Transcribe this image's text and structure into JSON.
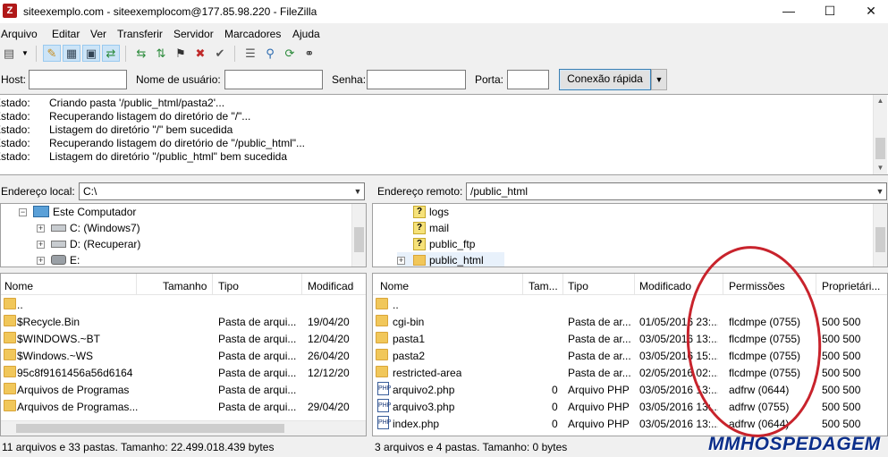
{
  "window": {
    "title": "siteexemplo.com - siteexemplocom@177.85.98.220 - FileZilla",
    "app_icon": "Z",
    "controls": {
      "minimize": "—",
      "maximize": "☐",
      "close": "✕"
    }
  },
  "menu": [
    "Arquivo",
    "Editar",
    "Ver",
    "Transferir",
    "Servidor",
    "Marcadores",
    "Ajuda"
  ],
  "toolbar_icons": [
    "site-manager-icon",
    "dropdown-arrow-icon",
    "toggle-log-icon",
    "toggle-local-tree-icon",
    "toggle-remote-tree-icon",
    "toggle-queue-icon",
    "refresh-icon",
    "process-queue-icon",
    "cancel-icon",
    "disconnect-icon",
    "reconnect-icon",
    "filter-icon",
    "compare-icon",
    "sync-browse-icon",
    "search-icon"
  ],
  "quickconnect": {
    "host_label": "Host:",
    "host_value": "",
    "user_label": "Nome de usuário:",
    "user_value": "",
    "pass_label": "Senha:",
    "pass_value": "",
    "port_label": "Porta:",
    "port_value": "",
    "button": "Conexão rápida",
    "dropdown": "▼"
  },
  "log": [
    {
      "key": "Estado:",
      "msg": "Criando pasta '/public_html/pasta2'..."
    },
    {
      "key": "Estado:",
      "msg": "Recuperando listagem do diretório de \"/\"..."
    },
    {
      "key": "Estado:",
      "msg": "Listagem do diretório \"/\" bem sucedida"
    },
    {
      "key": "Estado:",
      "msg": "Recuperando listagem do diretório de \"/public_html\"..."
    },
    {
      "key": "Estado:",
      "msg": "Listagem do diretório \"/public_html\" bem sucedida"
    }
  ],
  "local": {
    "address_label": "Endereço local:",
    "address_value": "C:\\",
    "tree": [
      {
        "label": "Este Computador",
        "icon": "computer-icon"
      },
      {
        "label": "C: (Windows7)",
        "icon": "drive-icon"
      },
      {
        "label": "D: (Recuperar)",
        "icon": "drive-icon"
      },
      {
        "label": "E:",
        "icon": "drive-icon"
      }
    ],
    "columns": [
      "Nome",
      "Tamanho",
      "Tipo",
      "Modificado"
    ],
    "files": [
      {
        "name": "..",
        "size": "",
        "type": "",
        "modified": ""
      },
      {
        "name": "$Recycle.Bin",
        "size": "",
        "type": "Pasta de arqui...",
        "modified": "19/04/20"
      },
      {
        "name": "$WINDOWS.~BT",
        "size": "",
        "type": "Pasta de arqui...",
        "modified": "12/04/20"
      },
      {
        "name": "$Windows.~WS",
        "size": "",
        "type": "Pasta de arqui...",
        "modified": "26/04/20"
      },
      {
        "name": "95c8f9161456a56d6164...",
        "size": "",
        "type": "Pasta de arqui...",
        "modified": "12/12/20"
      },
      {
        "name": "Arquivos de Programas",
        "size": "",
        "type": "Pasta de arqui...",
        "modified": ""
      },
      {
        "name": "Arquivos de Programas...",
        "size": "",
        "type": "Pasta de arqui...",
        "modified": "29/04/20"
      }
    ],
    "status": "11 arquivos e 33 pastas. Tamanho: 22.499.018.439 bytes"
  },
  "remote": {
    "address_label": "Endereço remoto:",
    "address_value": "/public_html",
    "tree": [
      {
        "label": "logs",
        "icon": "question-icon"
      },
      {
        "label": "mail",
        "icon": "question-icon"
      },
      {
        "label": "public_ftp",
        "icon": "question-icon"
      },
      {
        "label": "public_html",
        "icon": "folder-icon"
      }
    ],
    "columns": [
      "Nome",
      "Tam...",
      "Tipo",
      "Modificado",
      "Permissões",
      "Proprietári..."
    ],
    "files": [
      {
        "name": "..",
        "size": "",
        "type": "",
        "modified": "",
        "perms": "",
        "owner": "",
        "kind": "folder"
      },
      {
        "name": "cgi-bin",
        "size": "",
        "type": "Pasta de ar...",
        "modified": "01/05/2016 23:...",
        "perms": "flcdmpe (0755)",
        "owner": "500 500",
        "kind": "folder"
      },
      {
        "name": "pasta1",
        "size": "",
        "type": "Pasta de ar...",
        "modified": "03/05/2016 13:...",
        "perms": "flcdmpe (0755)",
        "owner": "500 500",
        "kind": "folder"
      },
      {
        "name": "pasta2",
        "size": "",
        "type": "Pasta de ar...",
        "modified": "03/05/2016 15:...",
        "perms": "flcdmpe (0755)",
        "owner": "500 500",
        "kind": "folder"
      },
      {
        "name": "restricted-area",
        "size": "",
        "type": "Pasta de ar...",
        "modified": "02/05/2016 02:...",
        "perms": "flcdmpe (0755)",
        "owner": "500 500",
        "kind": "folder"
      },
      {
        "name": "arquivo2.php",
        "size": "0",
        "type": "Arquivo PHP",
        "modified": "03/05/2016 13:...",
        "perms": "adfrw (0644)",
        "owner": "500 500",
        "kind": "php"
      },
      {
        "name": "arquivo3.php",
        "size": "0",
        "type": "Arquivo PHP",
        "modified": "03/05/2016 13:...",
        "perms": "adfrw (0755)",
        "owner": "500 500",
        "kind": "php"
      },
      {
        "name": "index.php",
        "size": "0",
        "type": "Arquivo PHP",
        "modified": "03/05/2016 13:...",
        "perms": "adfrw (0644)",
        "owner": "500 500",
        "kind": "php"
      }
    ],
    "status": "3 arquivos e 4 pastas. Tamanho: 0 bytes"
  },
  "watermark": "MMHOSPEDAGEM",
  "colors": {
    "annotation": "#c8232c",
    "watermark": "#0b2e8a",
    "folder": "#f1c75a"
  }
}
